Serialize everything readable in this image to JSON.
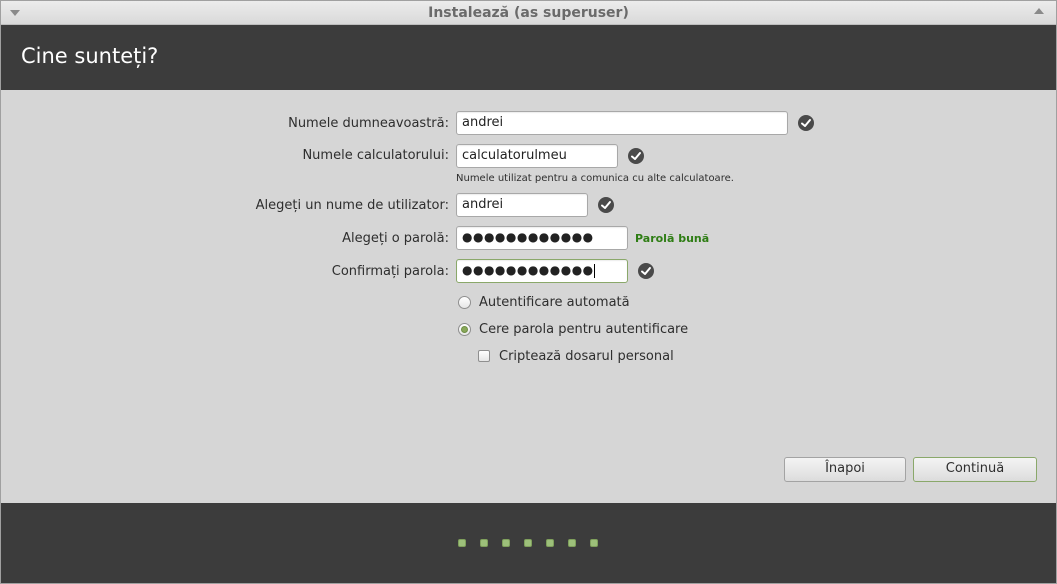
{
  "window": {
    "title": "Instalează (as superuser)"
  },
  "header": {
    "title": "Cine sunteți?"
  },
  "form": {
    "name": {
      "label": "Numele dumneavoastră:",
      "value": "andrei"
    },
    "computer": {
      "label": "Numele calculatorului:",
      "value": "calculatorulmeu",
      "hint": "Numele utilizat pentru a comunica cu alte calculatoare."
    },
    "username": {
      "label": "Alegeți un nume de utilizator:",
      "value": "andrei"
    },
    "password": {
      "label": "Alegeți o parolă:",
      "masked_value": "●●●●●●●●●●●●",
      "strength": "Parolă bună"
    },
    "confirm": {
      "label": "Confirmați parola:",
      "masked_value": "●●●●●●●●●●●●"
    },
    "login_options": [
      {
        "label": "Autentificare automată",
        "selected": false
      },
      {
        "label": "Cere parola pentru autentificare",
        "selected": true
      }
    ],
    "encrypt_home": {
      "label": "Criptează dosarul personal",
      "checked": false
    }
  },
  "buttons": {
    "back": "Înapoi",
    "continue": "Continuă"
  },
  "progress": {
    "steps_total": 7,
    "step_color": "#9dc07a"
  },
  "colors": {
    "header_bg": "#3c3c3c",
    "body_bg": "#d6d6d6",
    "strength_good": "#2e7d14",
    "accent": "#8aa86a"
  }
}
